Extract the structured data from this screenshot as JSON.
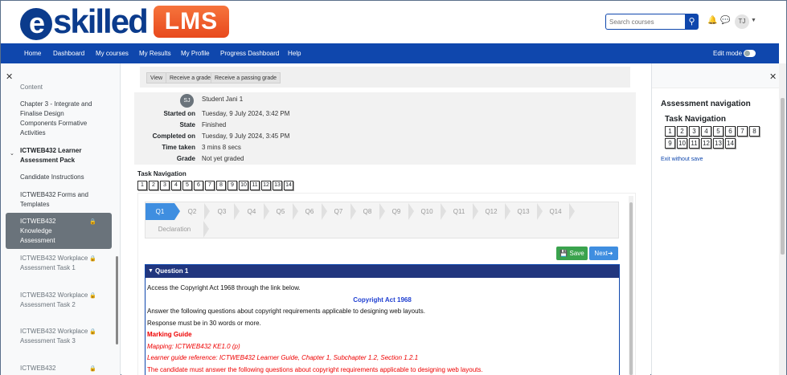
{
  "brand": {
    "logo_text": "eskilled",
    "badge": "LMS"
  },
  "search": {
    "placeholder": "Search courses"
  },
  "header": {
    "avatar_initials": "TJ"
  },
  "nav": {
    "items": [
      "Home",
      "Dashboard",
      "My courses",
      "My Results",
      "My Profile",
      "Progress Dashboard",
      "Help"
    ],
    "edit_mode_label": "Edit mode"
  },
  "left_drawer": {
    "partial_top": "Content",
    "items": [
      {
        "label": "Chapter 3 - Integrate and Finalise Design Components Formative Activities",
        "locked": false
      },
      {
        "label": "ICTWEB432 Learner Assessment Pack",
        "section": true
      },
      {
        "label": "Candidate Instructions",
        "locked": false
      },
      {
        "label": "ICTWEB432 Forms and Templates",
        "locked": false
      },
      {
        "label": "ICTWEB432 Knowledge Assessment",
        "locked": true,
        "active": true
      },
      {
        "label": "ICTWEB432 Workplace Assessment Task 1",
        "locked": true
      },
      {
        "label": "ICTWEB432 Workplace Assessment Task 2",
        "locked": true
      },
      {
        "label": "ICTWEB432 Workplace Assessment Task 3",
        "locked": true
      },
      {
        "label": "ICTWEB432",
        "locked": true
      }
    ]
  },
  "criteria_buttons": [
    "View",
    "Receive a grade",
    "Receive a passing grade"
  ],
  "summary": {
    "student_initials": "SJ",
    "student_name": "Student Jani 1",
    "rows": [
      {
        "label": "Started on",
        "value": "Tuesday, 9 July 2024, 3:42 PM"
      },
      {
        "label": "State",
        "value": "Finished"
      },
      {
        "label": "Completed on",
        "value": "Tuesday, 9 July 2024, 3:45 PM"
      },
      {
        "label": "Time taken",
        "value": "3 mins 8 secs"
      },
      {
        "label": "Grade",
        "value": "Not yet graded"
      }
    ]
  },
  "task_navigation": {
    "title": "Task Navigation",
    "boxes": [
      "1",
      "2",
      "3",
      "4",
      "5",
      "6",
      "7",
      "8",
      "9",
      "10",
      "11",
      "12",
      "13",
      "14"
    ]
  },
  "steps": {
    "items": [
      "Q1",
      "Q2",
      "Q3",
      "Q4",
      "Q5",
      "Q6",
      "Q7",
      "Q8",
      "Q9",
      "Q10",
      "Q11",
      "Q12",
      "Q13",
      "Q14"
    ],
    "active": "Q1",
    "declaration": "Declaration"
  },
  "buttons": {
    "save": "Save",
    "next": "Next"
  },
  "question": {
    "title": "Question 1",
    "lines": [
      {
        "text": "Access the Copyright Act 1968 through the link below.",
        "style": "normal"
      },
      {
        "text": "Copyright Act 1968",
        "style": "center"
      },
      {
        "text": "Answer the following questions about copyright requirements applicable to designing web layouts.",
        "style": "normal"
      },
      {
        "text": "Response must be in 30 words or more.",
        "style": "normal"
      },
      {
        "text": "Marking Guide",
        "style": "red-bold"
      },
      {
        "text": "Mapping: ICTWEB432 KE1.0 (p)",
        "style": "red-italic"
      },
      {
        "text": "Learner guide reference: ICTWEB432 Learner Guide, Chapter 1, Subchapter 1.2, Section 1.2.1",
        "style": "red-italic"
      },
      {
        "text": "The candidate must answer the following questions about copyright requirements applicable to designing web layouts.",
        "style": "red"
      }
    ]
  },
  "right_drawer": {
    "title": "Assessment navigation",
    "subtitle": "Task Navigation",
    "boxes": [
      "1",
      "2",
      "3",
      "4",
      "5",
      "6",
      "7",
      "8",
      "9",
      "10",
      "11",
      "12",
      "13",
      "14"
    ],
    "exit_label": "Exit without save"
  },
  "colors": {
    "primary": "#0f47ad",
    "nav_bg": "#0f47ad",
    "accent_orange": "#e8491d",
    "step_active": "#3f8ee0",
    "save_green": "#3aa34d",
    "marking_red": "#ee0000"
  },
  "icons": [
    "search-icon",
    "bell-icon",
    "chat-icon",
    "lock-icon",
    "close-icon",
    "save-icon",
    "arrow-right-icon"
  ]
}
